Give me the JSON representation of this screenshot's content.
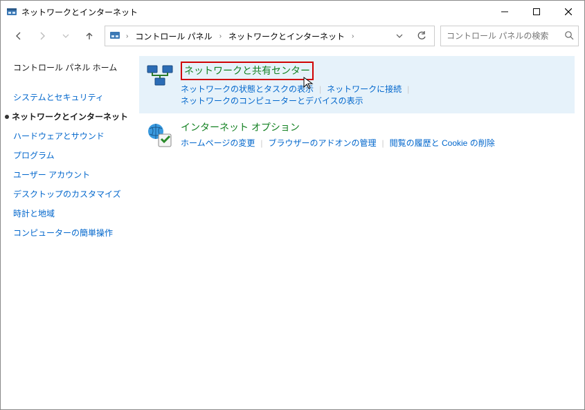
{
  "window": {
    "title": "ネットワークとインターネット"
  },
  "breadcrumb": {
    "root": "コントロール パネル",
    "current": "ネットワークとインターネット"
  },
  "search": {
    "placeholder": "コントロール パネルの検索"
  },
  "sidebar": {
    "home": "コントロール パネル ホーム",
    "items": [
      "システムとセキュリティ",
      "ネットワークとインターネット",
      "ハードウェアとサウンド",
      "プログラム",
      "ユーザー アカウント",
      "デスクトップのカスタマイズ",
      "時計と地域",
      "コンピューターの簡単操作"
    ],
    "active_index": 1
  },
  "categories": [
    {
      "title": "ネットワークと共有センター",
      "highlighted": true,
      "hovered": true,
      "links": [
        "ネットワークの状態とタスクの表示",
        "ネットワークに接続",
        "ネットワークのコンピューターとデバイスの表示"
      ]
    },
    {
      "title": "インターネット オプション",
      "highlighted": false,
      "hovered": false,
      "links": [
        "ホームページの変更",
        "ブラウザーのアドオンの管理",
        "閲覧の履歴と Cookie の削除"
      ]
    }
  ]
}
